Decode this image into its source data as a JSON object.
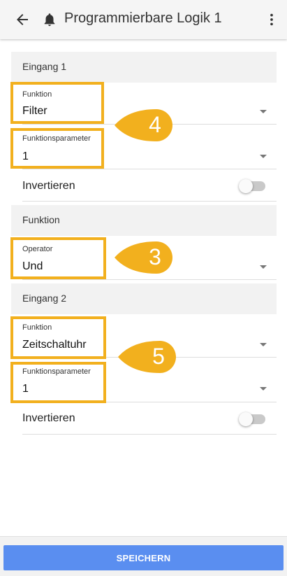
{
  "appbar": {
    "title": "Programmierbare Logik 1",
    "back_icon": "arrow-left-icon",
    "bell_icon": "bell-icon",
    "menu_icon": "more-vert-icon"
  },
  "input1": {
    "header": "Eingang 1",
    "function_label": "Funktion",
    "function_value": "Filter",
    "param_label": "Funktionsparameter",
    "param_value": "1",
    "invert_label": "Invertieren",
    "invert_on": false
  },
  "operator_section": {
    "header": "Funktion",
    "operator_label": "Operator",
    "operator_value": "Und"
  },
  "input2": {
    "header": "Eingang 2",
    "function_label": "Funktion",
    "function_value": "Zeitschaltuhr",
    "param_label": "Funktionsparameter",
    "param_value": "1",
    "invert_label": "Invertieren",
    "invert_on": false
  },
  "callouts": {
    "c4": "4",
    "c3": "3",
    "c5": "5"
  },
  "colors": {
    "highlight": "#f2b01e",
    "callout": "#f2b01e",
    "save_button": "#5a8ef0",
    "section_bg": "#f2f2f2"
  },
  "save_label": "SPEICHERN"
}
